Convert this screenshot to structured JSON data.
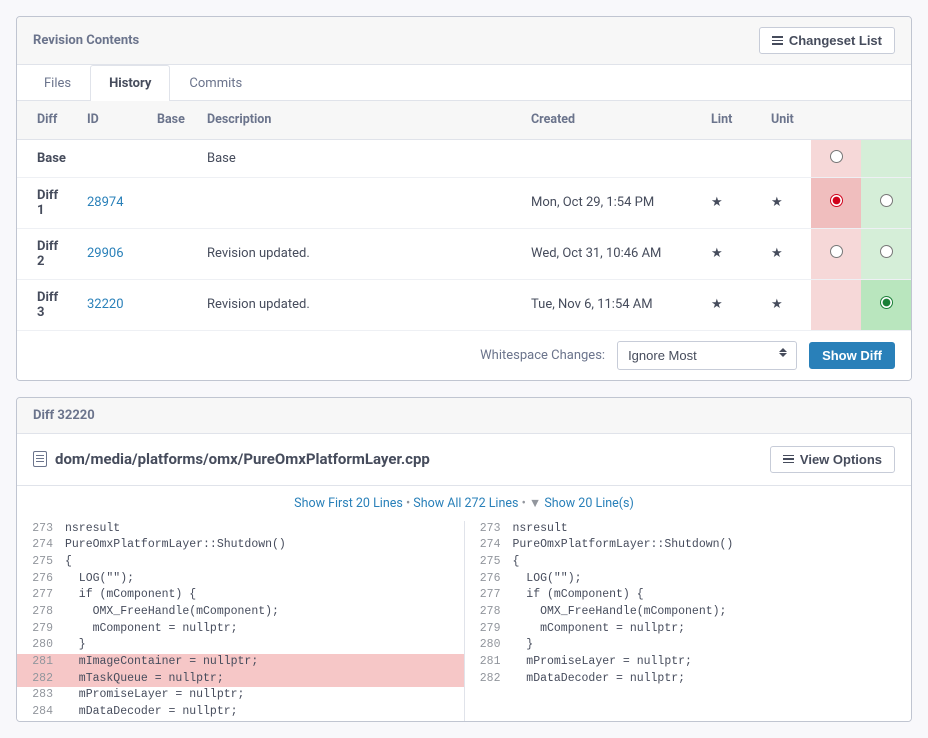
{
  "revisionPanel": {
    "title": "Revision Contents",
    "changesetBtn": "Changeset List",
    "tabs": {
      "files": "Files",
      "history": "History",
      "commits": "Commits"
    },
    "headers": {
      "diff": "Diff",
      "id": "ID",
      "base": "Base",
      "description": "Description",
      "created": "Created",
      "lint": "Lint",
      "unit": "Unit"
    },
    "rows": [
      {
        "diff": "Base",
        "id": "",
        "desc": "Base",
        "created": "",
        "lint": "",
        "unit": ""
      },
      {
        "diff": "Diff 1",
        "id": "28974",
        "desc": "",
        "created": "Mon, Oct 29, 1:54 PM",
        "lint": "★",
        "unit": "★"
      },
      {
        "diff": "Diff 2",
        "id": "29906",
        "desc": "Revision updated.",
        "created": "Wed, Oct 31, 10:46 AM",
        "lint": "★",
        "unit": "★"
      },
      {
        "diff": "Diff 3",
        "id": "32220",
        "desc": "Revision updated.",
        "created": "Tue, Nov 6, 11:54 AM",
        "lint": "★",
        "unit": "★"
      }
    ],
    "whitespaceLabel": "Whitespace Changes:",
    "whitespaceValue": "Ignore Most",
    "showDiffBtn": "Show Diff"
  },
  "diffPanel": {
    "title": "Diff 32220",
    "filePath": "dom/media/platforms/omx/PureOmxPlatformLayer.cpp",
    "viewOptions": "View Options",
    "shield": {
      "first": "Show First 20 Lines",
      "all": "Show All 272 Lines",
      "next": "Show 20 Line(s)"
    },
    "left": [
      {
        "n": "273",
        "t": "nsresult"
      },
      {
        "n": "274",
        "t": "PureOmxPlatformLayer::Shutdown()"
      },
      {
        "n": "275",
        "t": "{"
      },
      {
        "n": "276",
        "t": "  LOG(\"\");"
      },
      {
        "n": "277",
        "t": "  if (mComponent) {"
      },
      {
        "n": "278",
        "t": "    OMX_FreeHandle(mComponent);"
      },
      {
        "n": "279",
        "t": "    mComponent = nullptr;"
      },
      {
        "n": "280",
        "t": "  }"
      },
      {
        "n": "281",
        "t": "  mImageContainer = nullptr;",
        "removed": true
      },
      {
        "n": "282",
        "t": "  mTaskQueue = nullptr;",
        "removed": true
      },
      {
        "n": "283",
        "t": "  mPromiseLayer = nullptr;"
      },
      {
        "n": "284",
        "t": "  mDataDecoder = nullptr;"
      }
    ],
    "right": [
      {
        "n": "273",
        "t": "nsresult"
      },
      {
        "n": "274",
        "t": "PureOmxPlatformLayer::Shutdown()"
      },
      {
        "n": "275",
        "t": "{"
      },
      {
        "n": "276",
        "t": "  LOG(\"\");"
      },
      {
        "n": "277",
        "t": "  if (mComponent) {"
      },
      {
        "n": "278",
        "t": "    OMX_FreeHandle(mComponent);"
      },
      {
        "n": "279",
        "t": "    mComponent = nullptr;"
      },
      {
        "n": "280",
        "t": "  }"
      },
      {
        "n": "",
        "t": ""
      },
      {
        "n": "",
        "t": ""
      },
      {
        "n": "281",
        "t": "  mPromiseLayer = nullptr;"
      },
      {
        "n": "282",
        "t": "  mDataDecoder = nullptr;"
      }
    ]
  }
}
